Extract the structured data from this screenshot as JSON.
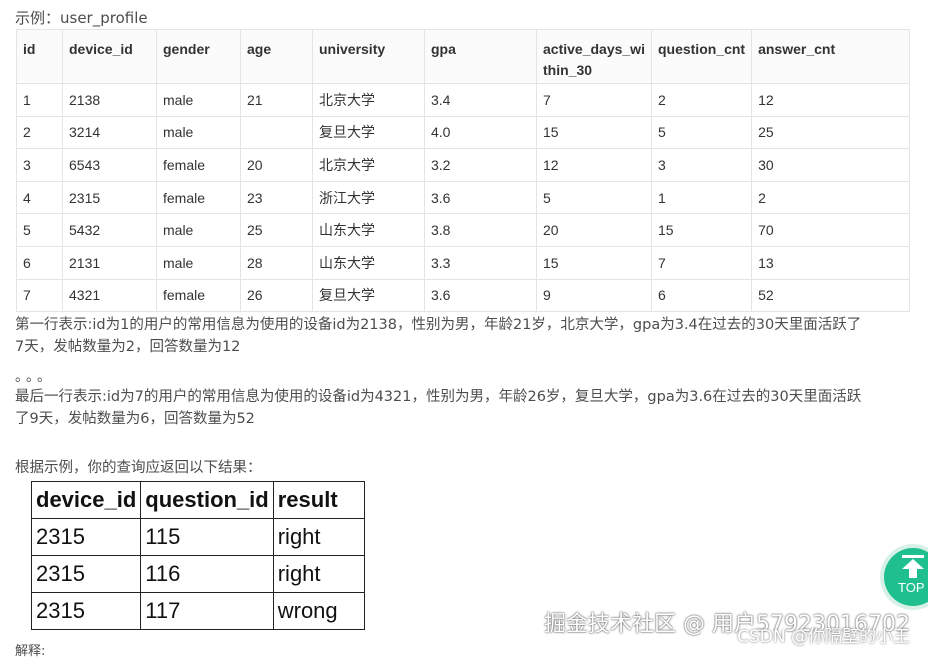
{
  "caption": "示例：user_profile",
  "main_table": {
    "headers": [
      "id",
      "device_id",
      "gender",
      "age",
      "university",
      "gpa",
      "active_days_wi thin_30",
      "question_cnt",
      "answer_cnt"
    ],
    "header_line1": [
      "id",
      "device_id",
      "gender",
      "age",
      "university",
      "gpa",
      "active_days_wi",
      "question_cnt",
      "answer_cnt"
    ],
    "header_line2": [
      "",
      "",
      "",
      "",
      "",
      "",
      "thin_30",
      "",
      ""
    ],
    "rows": [
      [
        "1",
        "2138",
        "male",
        "21",
        "北京大学",
        "3.4",
        "7",
        "2",
        "12"
      ],
      [
        "2",
        "3214",
        "male",
        "",
        "复旦大学",
        "4.0",
        "15",
        "5",
        "25"
      ],
      [
        "3",
        "6543",
        "female",
        "20",
        "北京大学",
        "3.2",
        "12",
        "3",
        "30"
      ],
      [
        "4",
        "2315",
        "female",
        "23",
        "浙江大学",
        "3.6",
        "5",
        "1",
        "2"
      ],
      [
        "5",
        "5432",
        "male",
        "25",
        "山东大学",
        "3.8",
        "20",
        "15",
        "70"
      ],
      [
        "6",
        "2131",
        "male",
        "28",
        "山东大学",
        "3.3",
        "15",
        "7",
        "13"
      ],
      [
        "7",
        "4321",
        "female",
        "26",
        "复旦大学",
        "3.6",
        "9",
        "6",
        "52"
      ]
    ]
  },
  "para1_line1": "第一行表示:id为1的用户的常用信息为使用的设备id为2138，性别为男，年龄21岁，北京大学，gpa为3.4在过去的30天里面活跃了",
  "para1_line2": "7天，发帖数量为2，回答数量为12",
  "dots": "。。。",
  "para2_line1": "最后一行表示:id为7的用户的常用信息为使用的设备id为4321，性别为男，年龄26岁，复旦大学，gpa为3.6在过去的30天里面活跃",
  "para2_line2": "了9天，发帖数量为6，回答数量为52",
  "para3": "根据示例，你的查询应返回以下结果：",
  "result_table": {
    "headers": [
      "device_id",
      "question_id",
      "result"
    ],
    "rows": [
      [
        "2315",
        "115",
        "right"
      ],
      [
        "2315",
        "116",
        "right"
      ],
      [
        "2315",
        "117",
        "wrong"
      ]
    ]
  },
  "bottom_cut": "解释:",
  "watermark1": "掘金技术社区 @ 用户57923016702",
  "watermark2": "CSDN @你隔壁的小王",
  "top_button": {
    "label": "TOP",
    "color": "#1fbf8f"
  }
}
